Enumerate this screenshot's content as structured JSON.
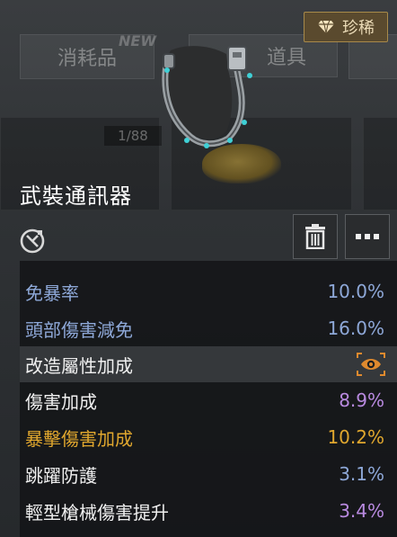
{
  "background": {
    "tabs": [
      "消耗品",
      "道具"
    ],
    "new_badge": "NEW",
    "counter": "1/88"
  },
  "item": {
    "rarity_label": "珍稀",
    "rarity_icon": "diamond-icon",
    "name": "武裝通訊器"
  },
  "actions": {
    "trash_icon": "trash-icon",
    "more_icon": "more-dots-icon",
    "tool_icon": "wrench-gear-icon"
  },
  "stats": [
    {
      "label": "免暴率",
      "value": "10.0%",
      "label_color": "#8ea8d8",
      "value_color": "#8ea8d8"
    },
    {
      "label": "頭部傷害減免",
      "value": "16.0%",
      "label_color": "#8ea8d8",
      "value_color": "#8ea8d8"
    },
    {
      "label": "改造屬性加成",
      "value": "",
      "label_color": "#f0f0f0",
      "value_color": "#e08a2e",
      "icon": "eye-icon",
      "highlight": true
    },
    {
      "label": "傷害加成",
      "value": "8.9%",
      "label_color": "#f0f0f0",
      "value_color": "#b98ae0"
    },
    {
      "label": "暴擊傷害加成",
      "value": "10.2%",
      "label_color": "#e0a72e",
      "value_color": "#e0a72e"
    },
    {
      "label": "跳躍防護",
      "value": "3.1%",
      "label_color": "#f0f0f0",
      "value_color": "#8ea8d8"
    },
    {
      "label": "輕型槍械傷害提升",
      "value": "3.4%",
      "label_color": "#f0f0f0",
      "value_color": "#b98ae0"
    }
  ],
  "colors": {
    "blue_stat": "#8ea8d8",
    "gold_stat": "#e0a72e",
    "purple_stat": "#b98ae0",
    "rarity_bg": "#5a4a2e",
    "mod_accent": "#e08a2e"
  }
}
